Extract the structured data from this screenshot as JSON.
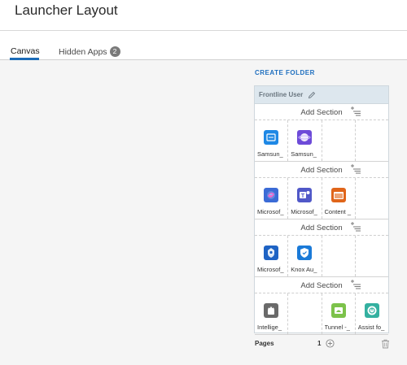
{
  "page": {
    "title": "Launcher Layout"
  },
  "tabs": [
    {
      "label": "Canvas",
      "active": true
    },
    {
      "label": "Hidden Apps",
      "badge": "2"
    }
  ],
  "actions": {
    "create_folder": "CREATE FOLDER"
  },
  "folder": {
    "name": "Frontline User",
    "sections": [
      {
        "add_label": "Add Section",
        "apps": [
          {
            "name": "Samsun_",
            "icon": "samsung-dex-icon",
            "color": "#1e88e5"
          },
          {
            "name": "Samsun_",
            "icon": "samsung-internet-icon",
            "color": "#6d4bd8"
          },
          null,
          null
        ]
      },
      {
        "add_label": "Add Section",
        "apps": [
          {
            "name": "Microsof_",
            "icon": "microsoft-copilot-icon",
            "color": "#3b6bd6"
          },
          {
            "name": "Microsof_",
            "icon": "microsoft-teams-icon",
            "color": "#5058c8"
          },
          {
            "name": "Content _",
            "icon": "content-folder-icon",
            "color": "#e0651a"
          },
          null
        ]
      },
      {
        "add_label": "Add Section",
        "apps": [
          {
            "name": "Microsof_",
            "icon": "microsoft-authenticator-icon",
            "color": "#1e63c4"
          },
          {
            "name": "Knox Au_",
            "icon": "knox-shield-icon",
            "color": "#1a7ad8"
          },
          null,
          null
        ]
      },
      {
        "add_label": "Add Section",
        "apps": [
          {
            "name": "Intellige_",
            "icon": "android-icon",
            "color": "#6a6a6a"
          },
          null,
          {
            "name": "Tunnel -_",
            "icon": "tunnel-icon",
            "color": "#7cc24a"
          },
          {
            "name": "Assist fo_",
            "icon": "assist-icon",
            "color": "#34b0a0"
          }
        ]
      }
    ]
  },
  "pages": {
    "label": "Pages",
    "current": "1"
  }
}
